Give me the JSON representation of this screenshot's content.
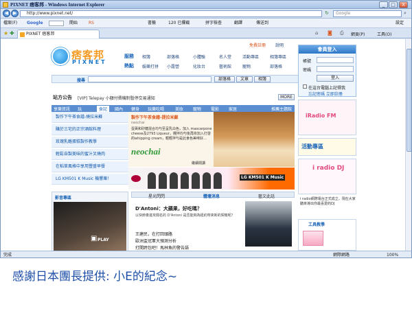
{
  "window": {
    "title": "PIXNET 痞客邦 - Windows Internet Explorer",
    "min": "_",
    "max": "□",
    "close": "X"
  },
  "address": {
    "url": "http://www.pixnet.net/",
    "search_placeholder": "Google"
  },
  "toolbar": {
    "items": [
      "檔案(F)",
      "Google",
      "開始",
      "RS",
      "書籤",
      "120 已攔截",
      "拼字檢查",
      "翻譯",
      "傳送到",
      "設定"
    ]
  },
  "tab": {
    "label": "PIXNET 痞客邦",
    "right_items": [
      "網頁(P)",
      "工具(O)"
    ]
  },
  "site": {
    "logo_cn": "痞客邦",
    "logo_en": "PIXNET",
    "top_links": [
      "免費註冊",
      "說明"
    ],
    "cat_label_1": "服務",
    "cat_label_2": "熱點",
    "cat_row_1": [
      "相簿",
      "部落格",
      "小體驗",
      "名人堂",
      "活動專區",
      "相簿專區"
    ],
    "cat_row_2": [
      "娛樂打拼",
      "小露營",
      "化妝台",
      "藝術館",
      "寵物",
      "部落格"
    ],
    "search_label": "搜尋",
    "search_buttons": [
      "部落格",
      "文章",
      "相簿"
    ],
    "announce_label": "站方公告",
    "announce_text": "[VIP] Telepay 小額付費機制暫停交易通知",
    "announce_more": "MORE",
    "menu_tabs": [
      "享樂資訊",
      "玩",
      "食記",
      "國內",
      "健身",
      "玩樂吃喝",
      "美妝",
      "寵物",
      "電影",
      "家居",
      "推薦主題館"
    ],
    "left_list": [
      "製作下午茶食譜-燒拉米蘇",
      "賺於三宅的正宗酒館料理",
      "玫瑰乳酪蛋糕製作教學",
      "輕鬆自製美味的蜜汁叉燒肉",
      "在稻草風格中享用豐盛早餐",
      "LG KM501 K Music 機響樂！"
    ],
    "promo_title": "製作下午茶食譜-提拉米蘇",
    "promo_author": "neochai",
    "promo_body": "蛋黃和砂糖混合均勻至呈乳白色，加入 mascarpone cheese及2793 Liqueur，攪拌均勻後再依加入打發的whipping cream，輕輕拌勻是此食色美味好...",
    "promo_brand": "neochai",
    "promo_more": "繼續閱讀",
    "ad_text": "LG KM501 K Music",
    "video_label": "影音專區",
    "video_play": "PLAY",
    "news_tabs": [
      "星光閃閃",
      "體壇消息",
      "藝文此話"
    ],
    "news_headline": "D'Antoni：大蘋果，好吃嗎？",
    "news_lead": "以快節奏進攻聞名的 D'Antoni 是否能夠為紐約帶來新的契機呢？",
    "news_lines": [
      "王建民，在打回頭路",
      "歐洲盃冠軍大預測分析",
      "打開跨包吧！馬林魚的警告語"
    ],
    "login_title": "會員登入",
    "login_account": "帳號",
    "login_password": "密碼",
    "login_button": "登入",
    "login_remember": "在這台電腦上記得我",
    "login_forgot": "忘記密碼 立即註冊",
    "fm_label": "iRadio FM",
    "event_label": "活動專區",
    "radio_label": "i radio DJ",
    "radio_caption": "i radio網際電台正式成立，現在大家聽來導出你最喜愛的DJ",
    "tools_label": "工具教學"
  },
  "status": {
    "left": "完成",
    "right": "網際網路",
    "zoom": "100%"
  },
  "caption": "感謝日本團長提供: 小E的紀念~"
}
